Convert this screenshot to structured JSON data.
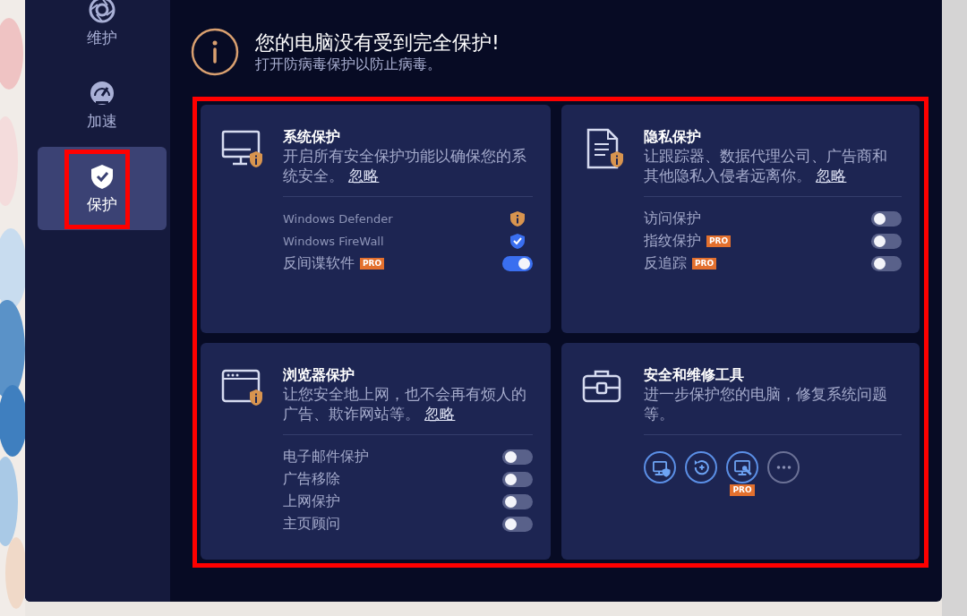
{
  "sidebar": {
    "items": [
      {
        "label": "维护",
        "kind": "maintain",
        "selected": false,
        "highlighted": false
      },
      {
        "label": "加速",
        "kind": "speed",
        "selected": false,
        "highlighted": false
      },
      {
        "label": "保护",
        "kind": "protect",
        "selected": true,
        "highlighted": true
      }
    ]
  },
  "alert": {
    "title": "您的电脑没有受到完全保护!",
    "message": "打开防病毒保护以防止病毒。"
  },
  "panel": {
    "highlighted": true,
    "cards": [
      {
        "kind": "system",
        "title": "系统保护",
        "description": "开启所有安全保护功能以确保您的系统安全。",
        "link": "忽略",
        "items": [
          {
            "kind": "warning",
            "label": "Windows Defender"
          },
          {
            "kind": "ok",
            "label": "Windows FireWall"
          },
          {
            "kind": "toggle",
            "label": "反间谍软件",
            "badge": "PRO",
            "on": true
          }
        ]
      },
      {
        "kind": "privacy",
        "title": "隐私保护",
        "description": "让跟踪器、数据代理公司、广告商和其他隐私入侵者远离你。",
        "link": "忽略",
        "items": [
          {
            "kind": "toggle",
            "label": "访问保护",
            "on": false
          },
          {
            "kind": "toggle",
            "label": "指纹保护",
            "badge": "PRO",
            "on": false
          },
          {
            "kind": "toggle",
            "label": "反追踪",
            "badge": "PRO",
            "on": false
          }
        ]
      },
      {
        "kind": "browser",
        "title": "浏览器保护",
        "description": "让您安全地上网，也不会再有烦人的广告、欺诈网站等。",
        "link": "忽略",
        "items": [
          {
            "kind": "toggle",
            "label": "电子邮件保护",
            "on": false
          },
          {
            "kind": "toggle",
            "label": "广告移除",
            "on": false
          },
          {
            "kind": "toggle",
            "label": "上网保护",
            "on": false
          },
          {
            "kind": "toggle",
            "label": "主页顾问",
            "on": false
          }
        ]
      },
      {
        "kind": "tools",
        "title": "安全和维修工具",
        "description": "进一步保护您的电脑，修复系统问题等。",
        "tools": [
          {
            "kind": "monitor-shield"
          },
          {
            "kind": "restore"
          },
          {
            "kind": "monitor-wrench",
            "badge": "PRO"
          },
          {
            "kind": "more"
          }
        ]
      }
    ]
  }
}
